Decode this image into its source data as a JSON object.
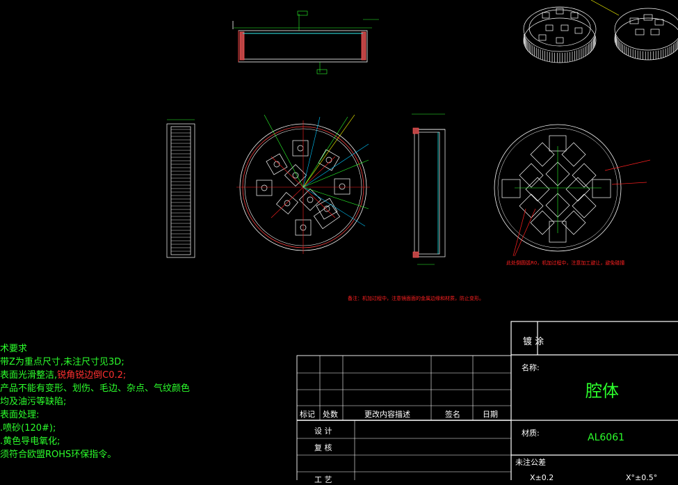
{
  "drawing": {
    "tech_requirements": {
      "title": "术要求",
      "line1": "带Z为重点尺寸,未注尺寸见3D;",
      "line2_a": "表面光滑整洁,",
      "line2_b": "锐角锐边倒C0.2;",
      "line3": "产品不能有变形、划伤、毛边、杂点、气纹颜色",
      "line4": "均及油污等缺陷;",
      "line5": "表面处理:",
      "line6": ".喷砂(120#);",
      "line7": ".黄色导电氧化;",
      "line8": "须符合欧盟ROHS环保指令。"
    },
    "notes": {
      "center_note": "备注：机加过程中，注意镜面面的金属边缘和材质，防止变形。",
      "right_note": "此处倒圆弧R0，机加过程中，注意加工避让，避免碰撞"
    },
    "revision_table": {
      "headers": [
        "标记",
        "处数",
        "更改内容描述",
        "签名",
        "日期"
      ],
      "rows_labels": [
        "设 计",
        "复 核",
        "工 艺"
      ]
    },
    "title_block": {
      "plating_label": "镀 涂",
      "name_label": "名称:",
      "part_name": "腔体",
      "material_label": "材质:",
      "material": "AL6061",
      "tolerance_label": "未注公差",
      "tol_1": "X±0.2",
      "tol_2": "X°±0.5°"
    },
    "colors": {
      "background": "#000000",
      "geometry": "#ffffff",
      "dimensions": "#2cff2c",
      "centerlines": "#ff2020",
      "leaders": "#00c8ff",
      "highlight": "#ffff00"
    }
  }
}
